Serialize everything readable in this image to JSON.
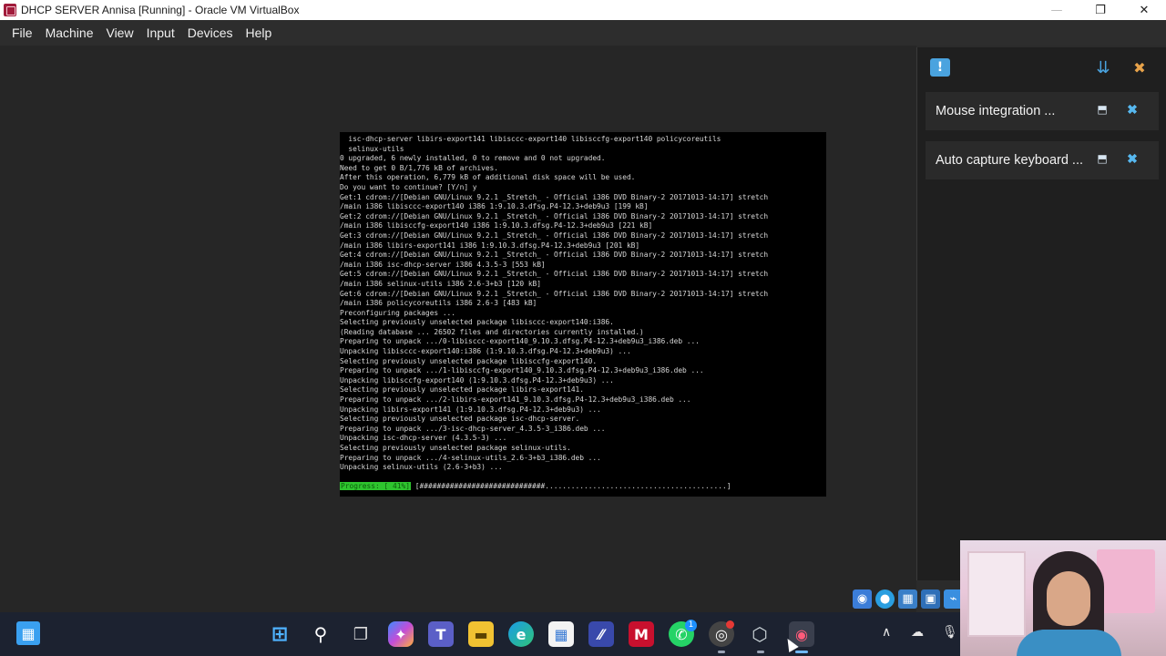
{
  "window": {
    "title": "DHCP SERVER Annisa [Running] - Oracle VM VirtualBox",
    "controls": [
      "—",
      "❐",
      "✕"
    ]
  },
  "menubar": {
    "items": [
      "File",
      "Machine",
      "View",
      "Input",
      "Devices",
      "Help"
    ]
  },
  "console": {
    "text": "  isc-dhcp-server libirs-export141 libisccc-export140 libisccfg-export140 policycoreutils\n  selinux-utils\n0 upgraded, 6 newly installed, 0 to remove and 0 not upgraded.\nNeed to get 0 B/1,776 kB of archives.\nAfter this operation, 6,779 kB of additional disk space will be used.\nDo you want to continue? [Y/n] y\nGet:1 cdrom://[Debian GNU/Linux 9.2.1 _Stretch_ - Official i386 DVD Binary-2 20171013-14:17] stretch\n/main i386 libisccc-export140 i386 1:9.10.3.dfsg.P4-12.3+deb9u3 [199 kB]\nGet:2 cdrom://[Debian GNU/Linux 9.2.1 _Stretch_ - Official i386 DVD Binary-2 20171013-14:17] stretch\n/main i386 libisccfg-export140 i386 1:9.10.3.dfsg.P4-12.3+deb9u3 [221 kB]\nGet:3 cdrom://[Debian GNU/Linux 9.2.1 _Stretch_ - Official i386 DVD Binary-2 20171013-14:17] stretch\n/main i386 libirs-export141 i386 1:9.10.3.dfsg.P4-12.3+deb9u3 [201 kB]\nGet:4 cdrom://[Debian GNU/Linux 9.2.1 _Stretch_ - Official i386 DVD Binary-2 20171013-14:17] stretch\n/main i386 isc-dhcp-server i386 4.3.5-3 [553 kB]\nGet:5 cdrom://[Debian GNU/Linux 9.2.1 _Stretch_ - Official i386 DVD Binary-2 20171013-14:17] stretch\n/main i386 selinux-utils i386 2.6-3+b3 [120 kB]\nGet:6 cdrom://[Debian GNU/Linux 9.2.1 _Stretch_ - Official i386 DVD Binary-2 20171013-14:17] stretch\n/main i386 policycoreutils i386 2.6-3 [483 kB]\nPreconfiguring packages ...\nSelecting previously unselected package libisccc-export140:i386.\n(Reading database ... 26502 files and directories currently installed.)\nPreparing to unpack .../0-libisccc-export140_9.10.3.dfsg.P4-12.3+deb9u3_i386.deb ...\nUnpacking libisccc-export140:i386 (1:9.10.3.dfsg.P4-12.3+deb9u3) ...\nSelecting previously unselected package libisccfg-export140.\nPreparing to unpack .../1-libisccfg-export140_9.10.3.dfsg.P4-12.3+deb9u3_i386.deb ...\nUnpacking libisccfg-export140 (1:9.10.3.dfsg.P4-12.3+deb9u3) ...\nSelecting previously unselected package libirs-export141.\nPreparing to unpack .../2-libirs-export141_9.10.3.dfsg.P4-12.3+deb9u3_i386.deb ...\nUnpacking libirs-export141 (1:9.10.3.dfsg.P4-12.3+deb9u3) ...\nSelecting previously unselected package isc-dhcp-server.\nPreparing to unpack .../3-isc-dhcp-server_4.3.5-3_i386.deb ...\nUnpacking isc-dhcp-server (4.3.5-3) ...\nSelecting previously unselected package selinux-utils.\nPreparing to unpack .../4-selinux-utils_2.6-3+b3_i386.deb ...\nUnpacking selinux-utils (2.6-3+b3) ...",
    "progress_label": "Progress: [ 41%]",
    "progress_bar": " [#############################..........................................] ",
    "progress_percent": 41
  },
  "notifications": {
    "items": [
      {
        "message": "Mouse integration ..."
      },
      {
        "message": "Auto capture keyboard ..."
      }
    ]
  },
  "taskbar": {
    "icons": [
      "windows-start-icon",
      "search-icon",
      "task-view-icon",
      "copilot-icon",
      "teams-icon",
      "file-explorer-icon",
      "edge-icon",
      "store-icon",
      "vscode-icon",
      "mcafee-icon",
      "whatsapp-icon",
      "chrome-icon",
      "virtualbox-icon",
      "vm-window-icon"
    ],
    "whatsapp_badge": "1"
  },
  "colors": {
    "accent": "#4aa3df",
    "progress_green": "#2ec42e"
  }
}
